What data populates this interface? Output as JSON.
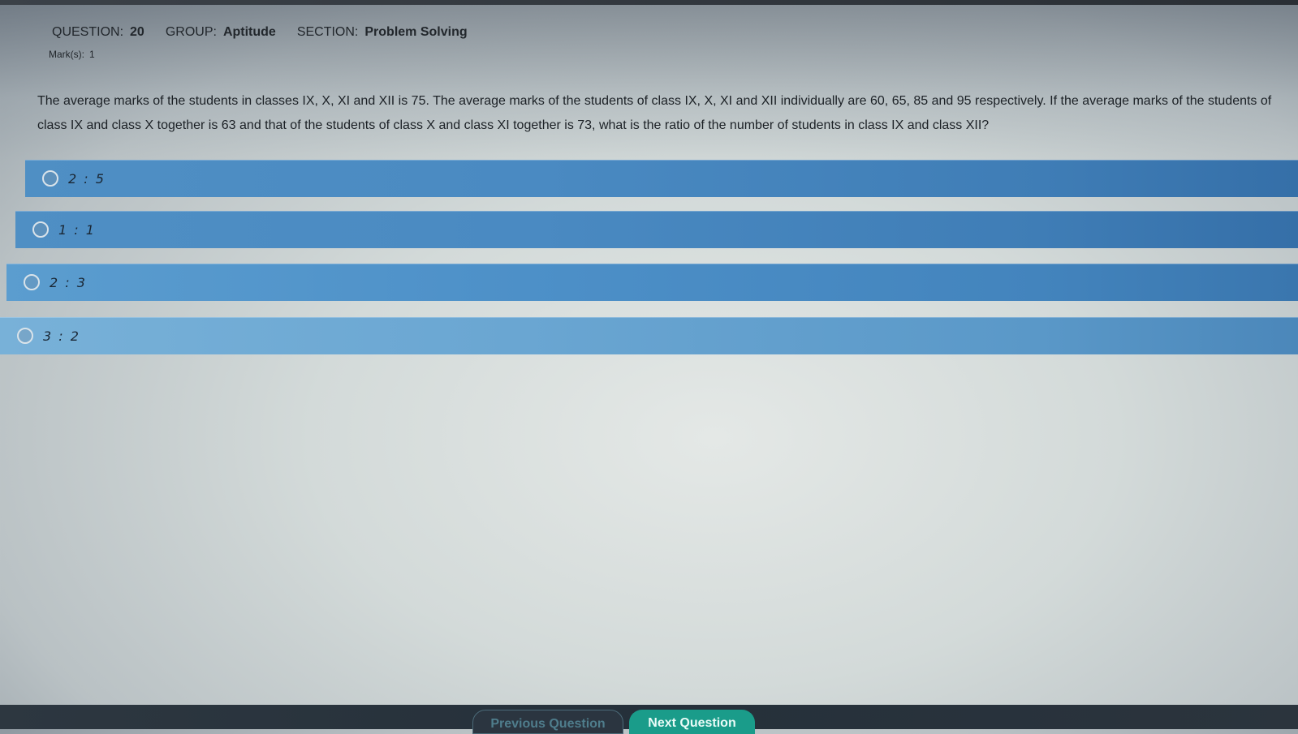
{
  "header": {
    "question_label": "QUESTION:",
    "question_number": "20",
    "group_label": "GROUP:",
    "group_value": "Aptitude",
    "section_label": "SECTION:",
    "section_value": "Problem Solving",
    "marks_label": "Mark(s):",
    "marks_value": "1"
  },
  "question": {
    "text": "The average marks of the students in classes IX, X, XI and XII is 75. The average marks of the students of class IX, X, XI and XII individually are 60, 65, 85 and 95 respectively. If the average marks of the students of class IX and class X together is 63 and that of the students of class X and class XI together is 73, what is the ratio of the number of students in class IX and class XII?"
  },
  "options": [
    {
      "label": "2 : 5",
      "selected": false
    },
    {
      "label": "1 : 1",
      "selected": false
    },
    {
      "label": "2 : 3",
      "selected": false
    },
    {
      "label": "3 : 2",
      "selected": false
    }
  ],
  "navigation": {
    "previous_label": "Previous Question",
    "next_label": "Next Question"
  },
  "colors": {
    "option_bar": "#4a8ac2",
    "next_button": "#1a9c8a",
    "bottom_bar": "#25303a"
  }
}
